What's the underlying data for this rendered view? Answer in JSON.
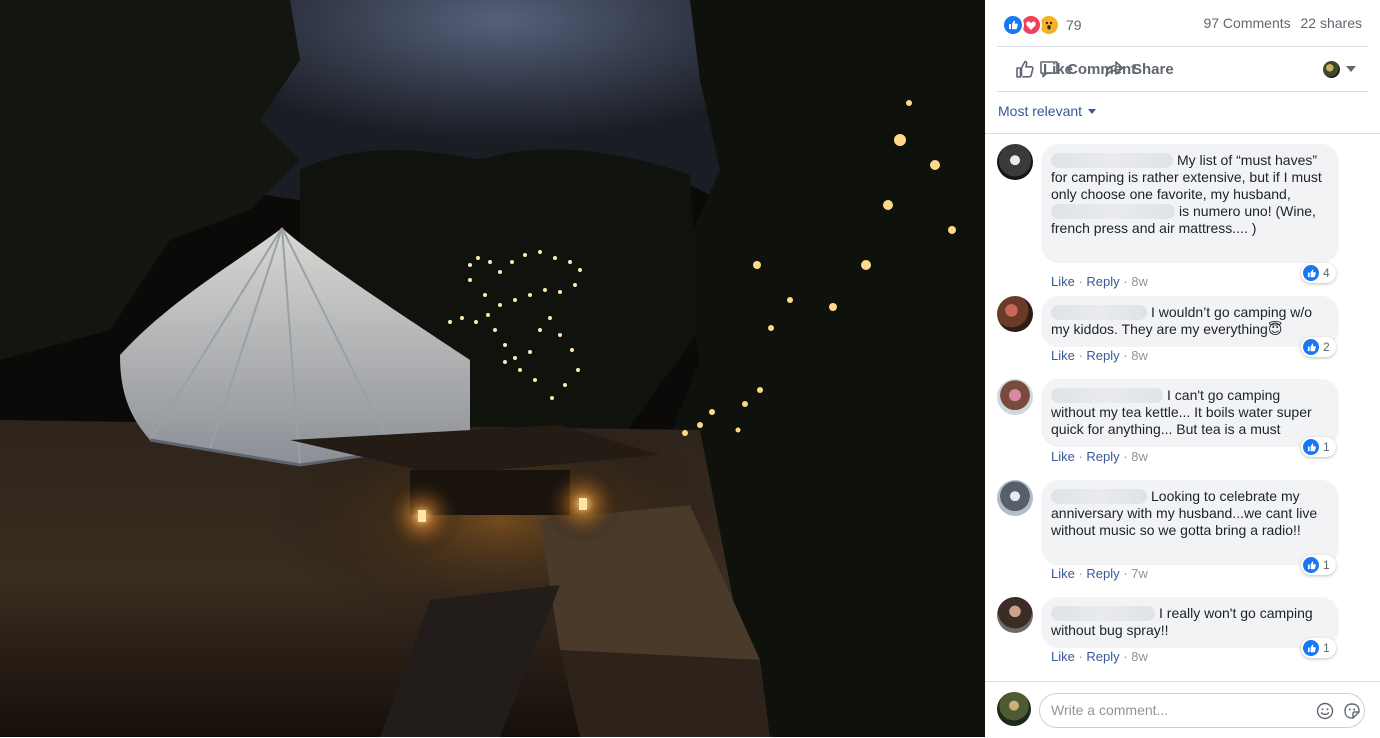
{
  "summary": {
    "reaction_count": "79",
    "comments_count": "97 Comments",
    "shares_count": "22 shares",
    "reaction_icons": [
      "like-icon",
      "love-icon",
      "wow-icon"
    ]
  },
  "actions": {
    "like_label": "Like",
    "comment_label": "Comment",
    "share_label": "Share"
  },
  "sort_label": "Most relevant",
  "comments": [
    {
      "pre": "My list of “must haves” for camping is rather extensive, but if I must only choose one favorite, my husband, ",
      "post": "is numero uno! (Wine, french press and air mattress.... )",
      "like": "Like",
      "reply": "Reply",
      "time": "8w",
      "likes": "4"
    },
    {
      "pre": "I wouldn’t go camping w/o my kiddos. They are my everything",
      "post": "😇",
      "like": "Like",
      "reply": "Reply",
      "time": "8w",
      "likes": "2"
    },
    {
      "pre": "I can't go camping without my tea kettle... It boils water super quick for anything... But tea is a must",
      "like": "Like",
      "reply": "Reply",
      "time": "8w",
      "likes": "1"
    },
    {
      "pre": "Looking to celebrate my anniversary with my husband...we cant live without music so we gotta bring a radio!!",
      "like": "Like",
      "reply": "Reply",
      "time": "7w",
      "likes": "1"
    },
    {
      "pre": "I really won't go camping without bug spray!!",
      "like": "Like",
      "reply": "Reply",
      "time": "8w",
      "likes": "1"
    }
  ],
  "write_comment": {
    "placeholder": "Write a comment...",
    "emoji_icon": "smiley-icon",
    "sticker_icon": "sticker-icon"
  },
  "colors": {
    "accent": "#1877f2",
    "link": "#385898",
    "love": "#f33e58",
    "wow": "#f7b125",
    "bubble": "#f2f3f5"
  }
}
